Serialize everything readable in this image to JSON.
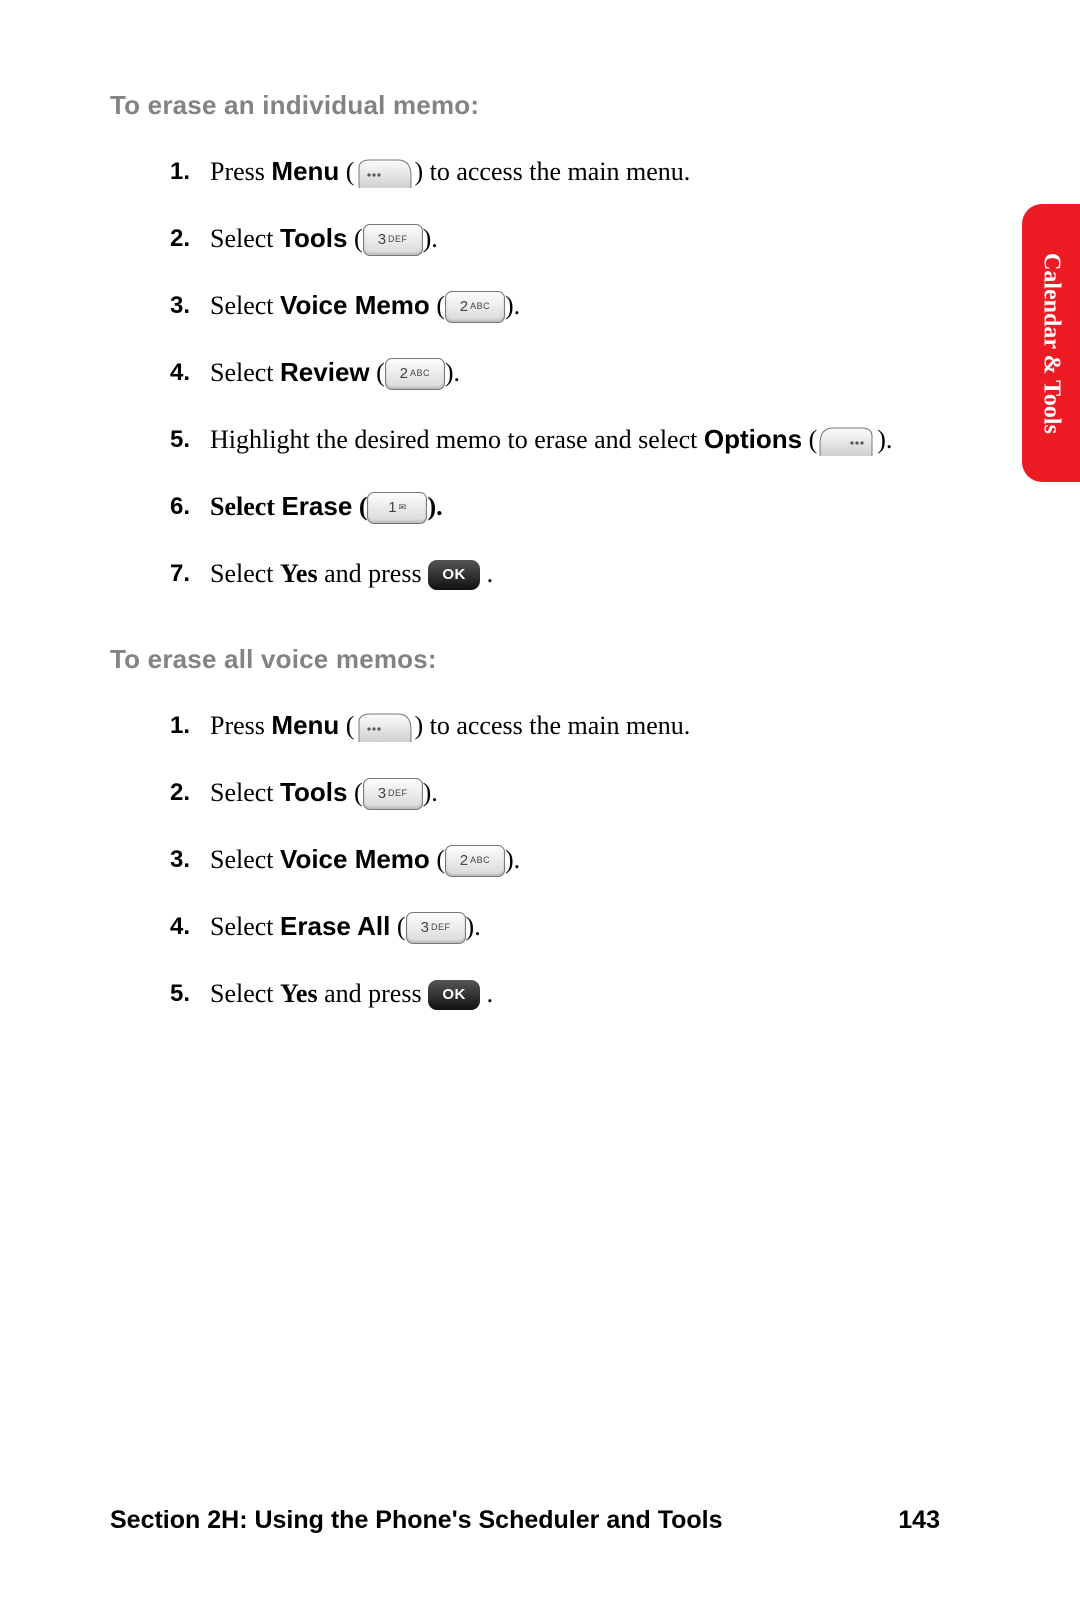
{
  "side_tab": "Calendar & Tools",
  "footer": {
    "section": "Section 2H: Using the Phone's Scheduler and Tools",
    "page": "143"
  },
  "blocks": [
    {
      "heading": "To erase an individual memo:",
      "steps": [
        {
          "n": "1.",
          "pre": "Press ",
          "bold": "Menu",
          "post": " to access the main menu.",
          "key": "soft-left"
        },
        {
          "n": "2.",
          "pre": "Select ",
          "bold": "Tools",
          "post": ".",
          "key": "3def"
        },
        {
          "n": "3.",
          "pre": "Select ",
          "bold": "Voice Memo",
          "post": ".",
          "key": "2abc"
        },
        {
          "n": "4.",
          "pre": "Select ",
          "bold": "Review",
          "post": ".",
          "key": "2abc"
        },
        {
          "n": "5.",
          "pre": "Highlight the desired memo to erase and select ",
          "bold": "Options",
          "post": ".",
          "key": "soft-right"
        },
        {
          "n": "6.",
          "pre": "Select ",
          "bold": "Erase",
          "post": ".",
          "boldAll": true,
          "key": "1mail"
        },
        {
          "n": "7.",
          "pre": "Select ",
          "bold": "Yes",
          "post2pre": " and press ",
          "post": ".",
          "key2": "ok"
        }
      ]
    },
    {
      "heading": "To erase all voice memos:",
      "steps": [
        {
          "n": "1.",
          "pre": "Press ",
          "bold": "Menu",
          "post": " to access the main menu.",
          "key": "soft-left"
        },
        {
          "n": "2.",
          "pre": "Select ",
          "bold": "Tools",
          "post": ".",
          "key": "3def"
        },
        {
          "n": "3.",
          "pre": "Select ",
          "bold": "Voice Memo",
          "post": ".",
          "key": "2abc"
        },
        {
          "n": "4.",
          "pre": "Select ",
          "bold": "Erase All",
          "post": ".",
          "key": "3def"
        },
        {
          "n": "5.",
          "pre": "Select ",
          "bold": "Yes",
          "post2pre": " and press ",
          "post": ".",
          "key2": "ok"
        }
      ]
    }
  ],
  "keys": {
    "3def": {
      "big": "3",
      "sm": "DEF"
    },
    "2abc": {
      "big": "2",
      "sm": "ABC"
    },
    "1mail": {
      "big": "1",
      "sm": "✉"
    },
    "ok": "OK"
  }
}
